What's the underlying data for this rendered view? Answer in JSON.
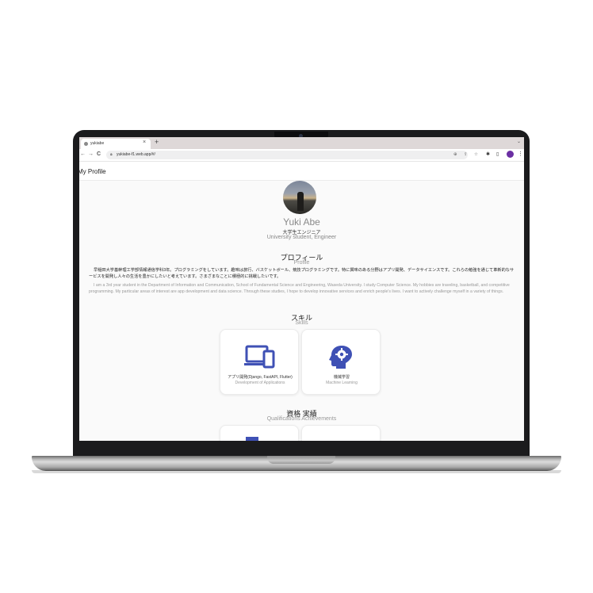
{
  "browser": {
    "tab_title": "yukiabe",
    "tab_close": "×",
    "new_tab": "+",
    "tab_menu": "⌄",
    "nav_back": "←",
    "nav_forward": "→",
    "nav_reload": "C",
    "url": "yukiabe-f1.web.app/#/"
  },
  "app": {
    "title": "My Profile"
  },
  "profile": {
    "name": "Yuki Abe",
    "role_jp": "大学生エンジニア",
    "role_en": "University student, Engineer"
  },
  "about": {
    "heading_jp": "プロフィール",
    "heading_en": "Profile",
    "text_jp": "早稲田大学基幹理工学部情報通信学科3年。プログラミングをしています。趣味は旅行、バスケットボール、競技プログラミングです。特に興味のある分野はアプリ開発、データサイエンスです。これらの勉強を通じて革新的なサービスを開発し人々の生活を豊かにしたいと考えています。さまざまなことに積極的に挑戦したいです。",
    "text_en": "I am a 3rd year student in the Department of Information and Communication, School of Fundamental Science and Engineering, Waseda University. I study Computer Science. My hobbies are traveling, basketball, and competitive programming. My particular areas of interest are app development and data science. Through these studies, I hope to develop innovative services and enrich people's lives. I want to actively challenge myself in a variety of things."
  },
  "skills": {
    "heading_jp": "スキル",
    "heading_en": "Skills",
    "items": [
      {
        "label_jp": "アプリ開発(Django, FastAPI, Flutter)",
        "label_en": "Development of Applications",
        "icon": "devices-icon"
      },
      {
        "label_jp": "機械学習",
        "label_en": "Machine Learning",
        "icon": "psychology-icon"
      }
    ]
  },
  "qualifications": {
    "heading_jp": "資格 実績",
    "heading_en": "Qualifications Achievements"
  },
  "colors": {
    "accent": "#3f51b5"
  }
}
